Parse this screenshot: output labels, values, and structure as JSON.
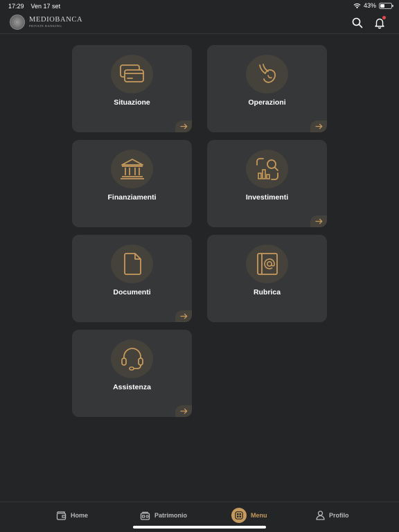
{
  "status_bar": {
    "time": "17:29",
    "date": "Ven 17 set",
    "battery": "43%",
    "battery_level": 0.43
  },
  "header": {
    "brand_name": "MEDIOBANCA",
    "brand_sub": "PRIVATE BANKING",
    "icons": [
      "search-icon",
      "bell-icon"
    ],
    "notification_dot_color": "#e5484d"
  },
  "colors": {
    "background": "#232527",
    "tile": "#353739",
    "icon_circle": "#45413b",
    "accent": "#c69a5c",
    "nav_inactive": "#b9b9b9"
  },
  "menu": {
    "tiles": [
      {
        "label": "Situazione",
        "icon": "cards-icon"
      },
      {
        "label": "Operazioni",
        "icon": "hand-coin-icon"
      },
      {
        "label": "Finanziamenti",
        "icon": "bank-icon"
      },
      {
        "label": "Investimenti",
        "icon": "chart-search-icon"
      },
      {
        "label": "Documenti",
        "icon": "document-icon"
      },
      {
        "label": "Rubrica",
        "icon": "address-book-icon"
      },
      {
        "label": "Assistenza",
        "icon": "headset-icon"
      }
    ]
  },
  "bottom_nav": {
    "items": [
      {
        "label": "Home",
        "icon": "wallet-icon"
      },
      {
        "label": "Patrimonio",
        "icon": "portfolio-icon"
      },
      {
        "label": "Menu",
        "icon": "menu-grid-icon"
      },
      {
        "label": "Profilo",
        "icon": "user-icon"
      }
    ],
    "active": "Menu"
  }
}
